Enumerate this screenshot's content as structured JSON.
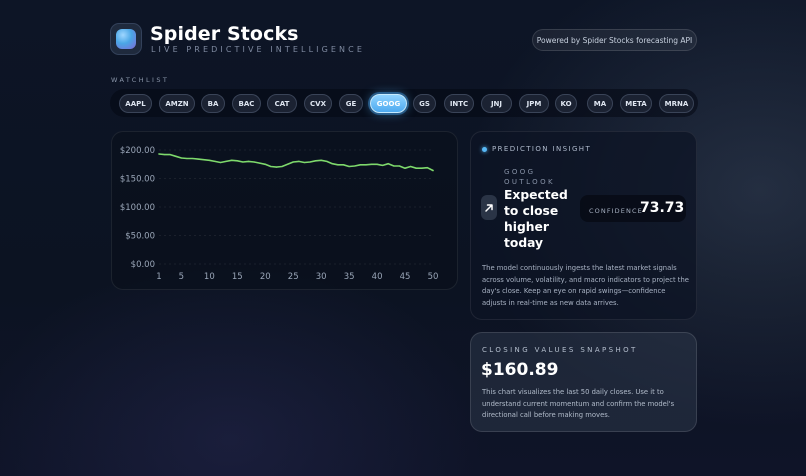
{
  "header": {
    "title": "Spider Stocks",
    "subtitle": "LIVE PREDICTIVE INTELLIGENCE",
    "powered_by": "Powered by Spider Stocks forecasting API"
  },
  "watchlist": {
    "label": "WATCHLIST",
    "selected": "GOOG",
    "tickers": [
      "AAPL",
      "AMZN",
      "BA",
      "BAC",
      "CAT",
      "CVX",
      "GE",
      "GOOG",
      "GS",
      "INTC",
      "JNJ",
      "JPM",
      "KO",
      "MA",
      "META",
      "MRNA"
    ]
  },
  "chart_data": {
    "type": "line",
    "x": [
      1,
      2,
      3,
      4,
      5,
      6,
      7,
      8,
      9,
      10,
      11,
      12,
      13,
      14,
      15,
      16,
      17,
      18,
      19,
      20,
      21,
      22,
      23,
      24,
      25,
      26,
      27,
      28,
      29,
      30,
      31,
      32,
      33,
      34,
      35,
      36,
      37,
      38,
      39,
      40,
      41,
      42,
      43,
      44,
      45,
      46,
      47,
      48,
      49,
      50
    ],
    "y": [
      193,
      192,
      192,
      189,
      186,
      185,
      185,
      184,
      183,
      182,
      180,
      178,
      180,
      182,
      181,
      179,
      180,
      179,
      177,
      175,
      171,
      170,
      171,
      175,
      179,
      180,
      178,
      179,
      181,
      182,
      180,
      176,
      174,
      174,
      171,
      172,
      174,
      174,
      175,
      175,
      173,
      176,
      172,
      172,
      168,
      171,
      168,
      168,
      169,
      164
    ],
    "xticks": [
      "1",
      "5",
      "10",
      "15",
      "20",
      "25",
      "30",
      "35",
      "40",
      "45",
      "50"
    ],
    "yticks": [
      "$0.00",
      "$50.00",
      "$100.00",
      "$150.00",
      "$200.00"
    ],
    "ylim": [
      0,
      200
    ],
    "line_color": "#7ed96c",
    "grid": true
  },
  "prediction": {
    "label": "PREDICTION INSIGHT",
    "outlook_label": "GOOG OUTLOOK",
    "direction": "Expected to close higher today",
    "arrow_icon": "arrow-up-right-icon",
    "confidence_label": "CONFIDENCE",
    "confidence_value": "73.73",
    "description": "The model continuously ingests the latest market signals across volume, volatility, and macro indicators to project the day's close. Keep an eye on rapid swings—confidence adjusts in real-time as new data arrives."
  },
  "snapshot": {
    "label": "CLOSING VALUES SNAPSHOT",
    "value": "$160.89",
    "description": "This chart visualizes the last 50 daily closes. Use it to understand current momentum and confirm the model's directional call before making moves."
  },
  "colors": {
    "accent": "#58b8f5",
    "active_ticker": "#4eaaf0",
    "line": "#7ed96c"
  }
}
